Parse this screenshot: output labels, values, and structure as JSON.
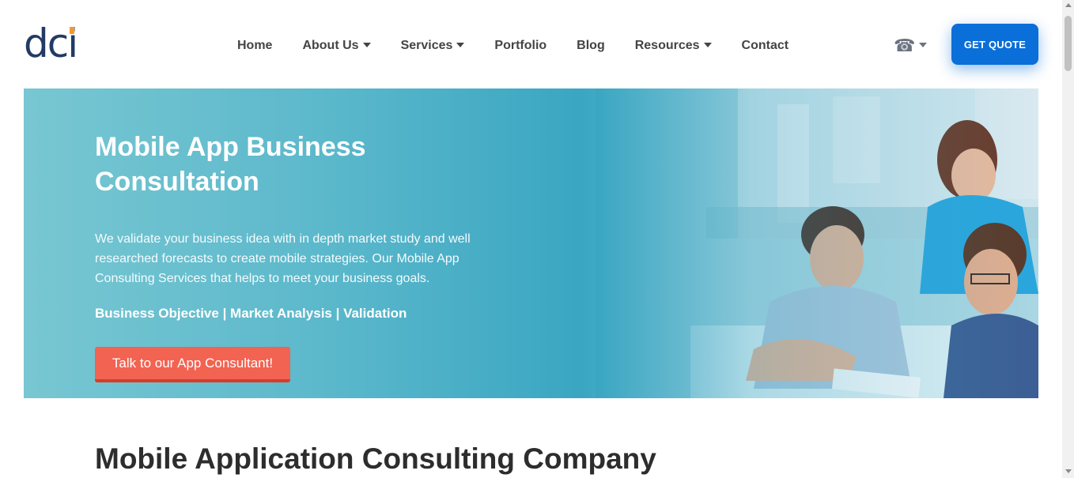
{
  "logo": {
    "text": "dci"
  },
  "nav": {
    "items": [
      {
        "label": "Home",
        "dropdown": false
      },
      {
        "label": "About Us",
        "dropdown": true
      },
      {
        "label": "Services",
        "dropdown": true
      },
      {
        "label": "Portfolio",
        "dropdown": false
      },
      {
        "label": "Blog",
        "dropdown": false
      },
      {
        "label": "Resources",
        "dropdown": true
      },
      {
        "label": "Contact",
        "dropdown": false
      }
    ]
  },
  "header": {
    "phone_icon": "phone-icon",
    "quote_label": "GET QUOTE"
  },
  "hero": {
    "title_line1": "Mobile App Business",
    "title_line2": "Consultation",
    "description": "We validate your business idea with in depth market study and well researched forecasts to create mobile strategies. Our Mobile App Consulting Services that helps to meet your business goals.",
    "tags": "Business Objective | Market Analysis | Validation",
    "cta_label": "Talk to our App Consultant!"
  },
  "section": {
    "title": "Mobile Application Consulting Company"
  },
  "colors": {
    "brand_navy": "#233a66",
    "brand_orange": "#f29a2e",
    "quote_blue": "#0a6fd8",
    "cta_red": "#f26352",
    "hero_teal": "#3aa6c2"
  }
}
